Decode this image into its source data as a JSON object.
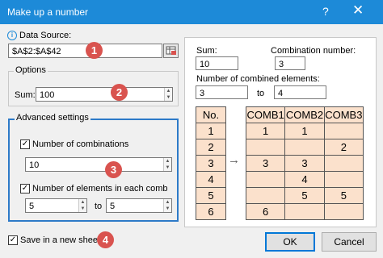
{
  "window": {
    "title": "Make up a number",
    "help_glyph": "?",
    "close_glyph": "✕"
  },
  "data_source": {
    "label": "Data Source:",
    "value": "$A$2:$A$42",
    "info_glyph": "i",
    "select_icon": "range-select-icon"
  },
  "options": {
    "legend": "Options",
    "sum_label": "Sum:",
    "sum_value": "100"
  },
  "advanced": {
    "legend": "Advanced settings",
    "num_combinations_label": "Number of combinations",
    "num_combinations_checked": true,
    "num_combinations_value": "10",
    "num_elements_label": "Number of elements in each comb",
    "num_elements_checked": true,
    "min_elements": "5",
    "to_label": "to",
    "max_elements": "5"
  },
  "save_new_sheet": {
    "label": "Save in a new sheet",
    "checked": true
  },
  "badges": [
    "1",
    "2",
    "3",
    "4"
  ],
  "preview": {
    "sum_label": "Sum:",
    "sum_value": "10",
    "combination_number_label": "Combination number:",
    "combination_number_value": "3",
    "combined_elements_label": "Number of combined elements:",
    "min_value": "3",
    "to_label": "to",
    "max_value": "4",
    "arrow": "→",
    "source_header": "No.",
    "source_values": [
      "1",
      "2",
      "3",
      "4",
      "5",
      "6"
    ],
    "result_headers": [
      "COMB1",
      "COMB2",
      "COMB3"
    ],
    "result_rows": [
      [
        "1",
        "1",
        ""
      ],
      [
        "",
        "",
        "2"
      ],
      [
        "3",
        "3",
        ""
      ],
      [
        "",
        "4",
        ""
      ],
      [
        "",
        "5",
        "5"
      ],
      [
        "6",
        "",
        ""
      ]
    ]
  },
  "buttons": {
    "ok": "OK",
    "cancel": "Cancel"
  },
  "colors": {
    "titlebar": "#1d8ad8",
    "highlight_border": "#2d7ac8",
    "badge": "#d9534f",
    "cell_fill": "#fbe1cc"
  }
}
